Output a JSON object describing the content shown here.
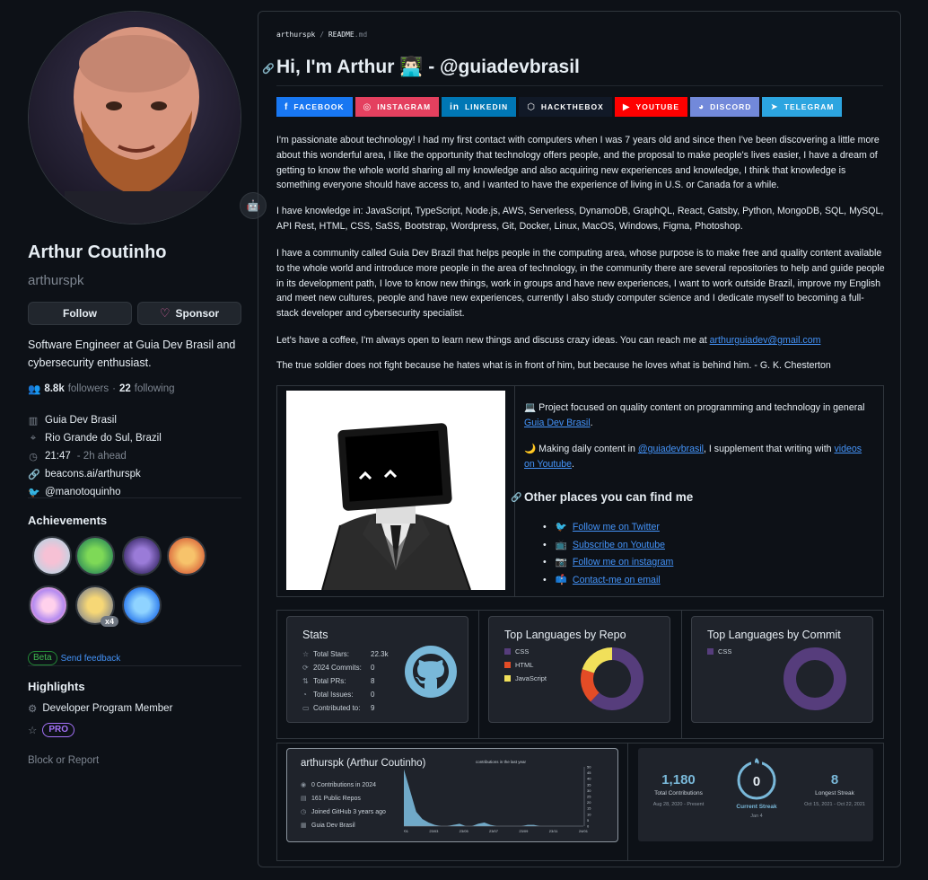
{
  "profile": {
    "name": "Arthur Coutinho",
    "login": "arthurspk",
    "follow_label": "Follow",
    "sponsor_label": "Sponsor",
    "bio": "Software Engineer at Guia Dev Brasil and cybersecurity enthusiast.",
    "followers_count": "8.8k",
    "followers_label": "followers",
    "following_count": "22",
    "following_label": "following",
    "company": "Guia Dev Brasil",
    "location": "Rio Grande do Sul, Brazil",
    "local_time": "21:47",
    "time_note": "- 2h ahead",
    "website": "beacons.ai/arthurspk",
    "twitter": "@manotoquinho"
  },
  "achievements": {
    "title": "Achievements",
    "multiplier": "x4",
    "beta_label": "Beta",
    "feedback_label": "Send feedback"
  },
  "highlights": {
    "title": "Highlights",
    "program": "Developer Program Member",
    "pro_label": "PRO"
  },
  "block_label": "Block or Report",
  "readme": {
    "path_user": "arthurspk",
    "path_sep": "/",
    "path_file": "README",
    "path_ext": ".md",
    "heading": "Hi, I'm Arthur 👨🏻‍💻 - @guiadevbrasil",
    "socials": [
      {
        "label": "FACEBOOK",
        "color": "#1877f2",
        "icon": "f"
      },
      {
        "label": "INSTAGRAM",
        "color": "#e4405f",
        "icon": "◎"
      },
      {
        "label": "LINKEDIN",
        "color": "#0077b5",
        "icon": "in"
      },
      {
        "label": "HACKTHEBOX",
        "color": "#111927",
        "icon": "⬡"
      },
      {
        "label": "YOUTUBE",
        "color": "#ff0000",
        "icon": "▶"
      },
      {
        "label": "DISCORD",
        "color": "#7289da",
        "icon": "◕"
      },
      {
        "label": "TELEGRAM",
        "color": "#2ca5e0",
        "icon": "➤"
      }
    ],
    "para1": "I'm passionate about technology! I had my first contact with computers when I was 7 years old and since then I've been discovering a little more about this wonderful area, I like the opportunity that technology offers people, and the proposal to make people's lives easier, I have a dream of getting to know the whole world sharing all my knowledge and also acquiring new experiences and knowledge, I think that knowledge is something everyone should have access to, and I wanted to have the experience of living in U.S. or Canada for a while.",
    "para2": "I have knowledge in: JavaScript, TypeScript, Node.js, AWS, Serverless, DynamoDB, GraphQL, React, Gatsby, Python, MongoDB, SQL, MySQL, API Rest, HTML, CSS, SaSS, Bootstrap, Wordpress, Git, Docker, Linux, MacOS, Windows, Figma, Photoshop.",
    "para3": "I have a community called Guia Dev Brazil that helps people in the computing area, whose purpose is to make free and quality content available to the whole world and introduce more people in the area of technology, in the community there are several repositories to help and guide people in its development path, I love to know new things, work in groups and have new experiences, I want to work outside Brazil, improve my English and meet new cultures, people and have new experiences, currently I also study computer science and I dedicate myself to becoming a full-stack developer and cybersecurity specialist.",
    "para4_text": "Let's have a coffee, I'm always open to learn new things and discuss crazy ideas. You can reach me at ",
    "email": "arthurguiadev@gmail.com",
    "quote": "The true soldier does not fight because he hates what is in front of him, but because he loves what is behind him. - G. K. Chesterton",
    "project_text": "💻 Project focused on quality content on programming and technology in general ",
    "project_link": "Guia Dev Brasil",
    "daily_text1": "🌙 Making daily content in ",
    "daily_handle": "@guiadevbrasil",
    "daily_text2": ", I supplement that writing with ",
    "daily_link": "videos on Youtube",
    "places_title": "Other places you can find me",
    "places": [
      {
        "icon": "🐦",
        "label": "Follow me on Twitter"
      },
      {
        "icon": "📺",
        "label": "Subscribe on Youtube"
      },
      {
        "icon": "📷",
        "label": "Follow me on instagram"
      },
      {
        "icon": "📫",
        "label": "Contact-me on email"
      }
    ]
  },
  "stats_card": {
    "title": "Stats",
    "rows": [
      {
        "icon": "☆",
        "label": "Total Stars:",
        "value": "22.3k"
      },
      {
        "icon": "⟳",
        "label": "2024 Commits:",
        "value": "0"
      },
      {
        "icon": "⇅",
        "label": "Total PRs:",
        "value": "8"
      },
      {
        "icon": "◔",
        "label": "Total Issues:",
        "value": "0"
      },
      {
        "icon": "▭",
        "label": "Contributed to:",
        "value": "9"
      }
    ]
  },
  "lang_repo": {
    "title": "Top Languages by Repo",
    "legend": [
      {
        "name": "CSS",
        "color": "#563d7c"
      },
      {
        "name": "HTML",
        "color": "#e34c26"
      },
      {
        "name": "JavaScript",
        "color": "#f1e05a"
      }
    ],
    "share": [
      0.62,
      0.18,
      0.2
    ]
  },
  "lang_commit": {
    "title": "Top Languages by Commit",
    "legend": [
      {
        "name": "CSS",
        "color": "#563d7c"
      }
    ],
    "share": [
      1
    ]
  },
  "activity": {
    "title": "arthurspk (Arthur Coutinho)",
    "caption": "contributions in the last year",
    "rows": [
      {
        "icon": "◉",
        "label": "0 Contributions in 2024"
      },
      {
        "icon": "▤",
        "label": "161 Public Repos"
      },
      {
        "icon": "◷",
        "label": "Joined GitHub 3 years ago"
      },
      {
        "icon": "▦",
        "label": "Guia Dev Brasil"
      }
    ],
    "y_ticks": [
      "50",
      "45",
      "40",
      "35",
      "30",
      "25",
      "20",
      "15",
      "10",
      "5",
      "0"
    ],
    "x_ticks": [
      "23/01",
      "23/03",
      "23/05",
      "23/07",
      "23/09",
      "23/11",
      "24/01"
    ],
    "series": [
      48,
      30,
      12,
      6,
      3,
      1,
      0,
      0,
      1,
      2,
      0,
      0,
      2,
      3,
      1,
      0,
      0,
      0,
      0,
      0,
      1,
      1,
      0,
      0,
      0,
      0,
      0,
      0,
      0,
      0
    ]
  },
  "streak": {
    "total": "1,180",
    "total_label": "Total Contributions",
    "total_range": "Aug 28, 2020 - Present",
    "current": "0",
    "current_label": "Current Streak",
    "current_date": "Jan 4",
    "longest": "8",
    "longest_label": "Longest Streak",
    "longest_range": "Oct 15, 2021 - Oct 22, 2021"
  }
}
